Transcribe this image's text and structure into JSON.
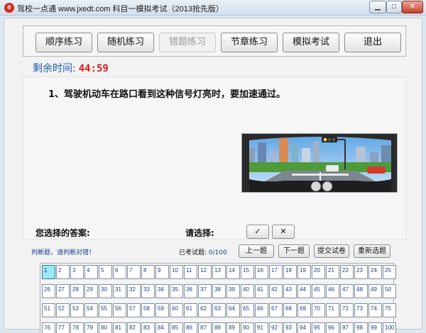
{
  "window": {
    "title": "驾校一点通 www.jxedt.com 科目一模拟考试（2013抢先版）",
    "icon": "app-logo-icon",
    "controls": [
      "minimize-icon",
      "maximize-icon",
      "close-icon"
    ],
    "control_glyphs": {
      "minimize": "▁",
      "maximize": "□",
      "close": "✕"
    }
  },
  "toolbar": {
    "buttons": [
      {
        "label": "顺序练习",
        "enabled": true
      },
      {
        "label": "随机练习",
        "enabled": true
      },
      {
        "label": "错题练习",
        "enabled": false
      },
      {
        "label": "节章练习",
        "enabled": true
      },
      {
        "label": "模拟考试",
        "enabled": true
      },
      {
        "label": "退出",
        "enabled": true
      }
    ]
  },
  "timer": {
    "label": "剩余时间:",
    "value": "44:59"
  },
  "question": {
    "text": "1、驾驶机动车在路口看到这种信号灯亮时，要加速通过。",
    "image": "traffic-light-driver-view"
  },
  "answer": {
    "your_answer_label": "您选择的答案:",
    "choose_label": "请选择:",
    "options": [
      "✓",
      "✕"
    ]
  },
  "status": {
    "hint": "判断题，请判断对错！",
    "done_label": "已考试题:",
    "done_value": "0/100"
  },
  "nav": {
    "prev": "上一题",
    "next": "下一题",
    "submit": "提交试卷",
    "reselect": "重新选题"
  },
  "grid": {
    "current": 1,
    "cells": [
      "1",
      "2",
      "3",
      "4",
      "5",
      "6",
      "7",
      "8",
      "9",
      "10",
      "11",
      "12",
      "13",
      "14",
      "15",
      "16",
      "17",
      "18",
      "19",
      "20",
      "21",
      "22",
      "23",
      "24",
      "25",
      "26",
      "27",
      "28",
      "29",
      "30",
      "31",
      "32",
      "33",
      "34",
      "35",
      "36",
      "37",
      "38",
      "39",
      "40",
      "41",
      "42",
      "43",
      "44",
      "45",
      "46",
      "47",
      "48",
      "49",
      "50",
      "51",
      "52",
      "53",
      "54",
      "55",
      "56",
      "57",
      "58",
      "59",
      "60",
      "61",
      "62",
      "63",
      "64",
      "65",
      "66",
      "67",
      "68",
      "69",
      "70",
      "71",
      "72",
      "73",
      "74",
      "75",
      "76",
      "77",
      "78",
      "79",
      "80",
      "81",
      "82",
      "83",
      "84",
      "85",
      "86",
      "87",
      "88",
      "89",
      "90",
      "91",
      "92",
      "93",
      "94",
      "95",
      "96",
      "97",
      "98",
      "99",
      "100"
    ]
  },
  "colors": {
    "accent": "#1f5bb0",
    "timer": "#d41f1f",
    "current_cell": "#9ae8f6",
    "link": "#1a3f8c"
  }
}
